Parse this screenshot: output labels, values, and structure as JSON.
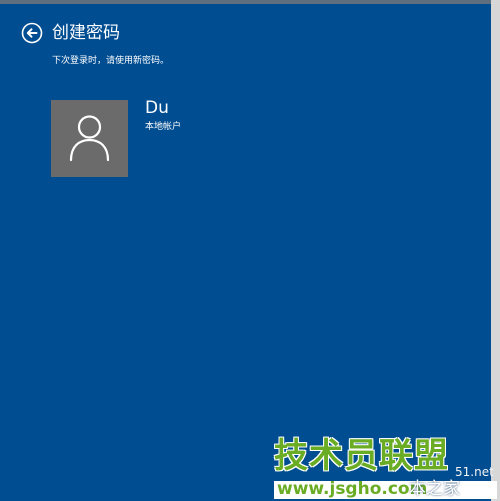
{
  "header": {
    "title": "创建密码",
    "subtitle": "下次登录时，请使用新密码。",
    "back_icon": "back-arrow-icon"
  },
  "account": {
    "name": "Du",
    "type": "本地帐户",
    "avatar_icon": "user-icon"
  },
  "watermark": {
    "main": "技术员联盟",
    "net": "51.net",
    "site": "www.jsgho.com",
    "suffix": "本之家"
  },
  "colors": {
    "background": "#004d92",
    "avatar_bg": "#6b6b6b",
    "watermark_green": "#6aac24"
  }
}
